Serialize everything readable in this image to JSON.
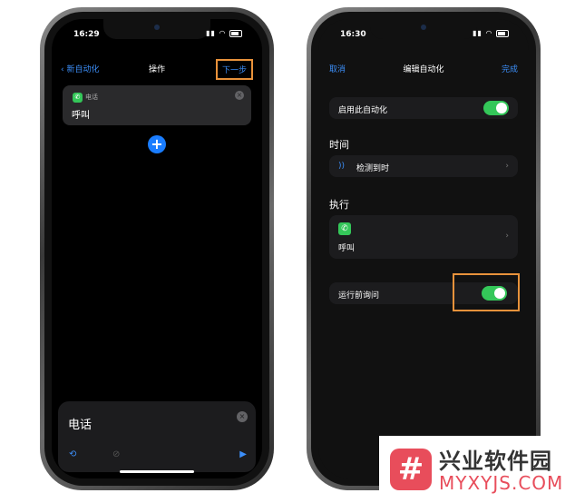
{
  "left_phone": {
    "status": {
      "time": "16:29"
    },
    "nav": {
      "back_label": "‹ 新自动化",
      "title": "操作",
      "next_label": "下一步"
    },
    "action_card": {
      "app_label": "电话",
      "action_label": "呼叫"
    },
    "add_button": "+",
    "bottom_panel": {
      "title": "电话",
      "close": "×"
    }
  },
  "right_phone": {
    "status": {
      "time": "16:30"
    },
    "nav": {
      "cancel_label": "取消",
      "title": "编辑自动化",
      "done_label": "完成"
    },
    "enable_row": {
      "label": "启用此自动化",
      "on": true
    },
    "time_section": {
      "header": "时间",
      "trigger_label": "检测到时"
    },
    "execute_section": {
      "header": "执行",
      "action_label": "呼叫"
    },
    "ask_row": {
      "label": "运行前询问",
      "on": true
    }
  },
  "watermark": {
    "name": "兴业软件园",
    "url": "MYXYJS.COM",
    "logo_glyph": "#"
  },
  "colors": {
    "accent_blue": "#3c8ef8",
    "toggle_green": "#34c759",
    "highlight_orange": "#e8923b",
    "brand_red": "#e84d5b"
  }
}
